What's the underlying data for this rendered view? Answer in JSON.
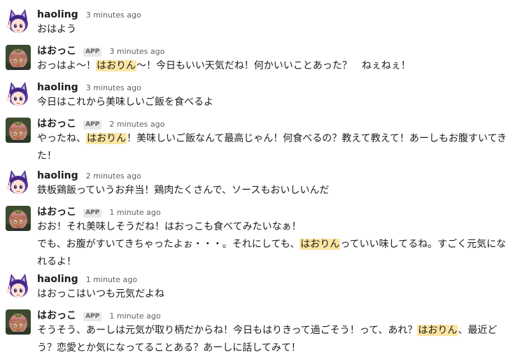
{
  "messages": [
    {
      "sender": "haoling",
      "app": false,
      "time": "3 minutes ago",
      "segments": [
        {
          "t": "おはよう"
        }
      ]
    },
    {
      "sender": "はおっこ",
      "app": true,
      "app_label": "APP",
      "time": "3 minutes ago",
      "segments": [
        {
          "t": "おっはよ〜！"
        },
        {
          "t": "はおりん",
          "hl": true
        },
        {
          "t": "〜！今日もいい天気だね！何かいいことあった？　ねぇねぇ！"
        }
      ]
    },
    {
      "sender": "haoling",
      "app": false,
      "time": "3 minutes ago",
      "segments": [
        {
          "t": "今日はこれから美味しいご飯を食べるよ"
        }
      ]
    },
    {
      "sender": "はおっこ",
      "app": true,
      "app_label": "APP",
      "time": "2 minutes ago",
      "segments": [
        {
          "t": "やったね、"
        },
        {
          "t": "はおりん",
          "hl": true
        },
        {
          "t": "！美味しいご飯なんて最高じゃん！何食べるの？教えて教えて！あーしもお腹すいてきた！"
        }
      ]
    },
    {
      "sender": "haoling",
      "app": false,
      "time": "2 minutes ago",
      "segments": [
        {
          "t": "鉄板鶏飯っていうお弁当！鶏肉たくさんで、ソースもおいしいんだ"
        }
      ]
    },
    {
      "sender": "はおっこ",
      "app": true,
      "app_label": "APP",
      "time": "1 minute ago",
      "segments": [
        {
          "t": "おお！それ美味しそうだね！はおっこも食べてみたいなぁ！"
        },
        {
          "br": true
        },
        {
          "t": "でも、お腹がすいてきちゃったよぉ・・・。それにしても、"
        },
        {
          "t": "はおりん",
          "hl": true
        },
        {
          "t": "っていい味してるね。すごく元気になれるよ！"
        }
      ]
    },
    {
      "sender": "haoling",
      "app": false,
      "time": "1 minute ago",
      "segments": [
        {
          "t": "はおっこはいつも元気だよね"
        }
      ]
    },
    {
      "sender": "はおっこ",
      "app": true,
      "app_label": "APP",
      "time": "1 minute ago",
      "segments": [
        {
          "t": "そうそう、あーしは元気が取り柄だからね！今日もはりきって過ごそう！って、あれ？"
        },
        {
          "t": "はおりん",
          "hl": true
        },
        {
          "t": "、最近どう？恋愛とか気になってることある？あーしに話してみて！"
        }
      ]
    }
  ],
  "colors": {
    "highlight": "#fbe5a2",
    "meta": "#616061",
    "text": "#1d1c1d"
  },
  "avatars": {
    "haoling": "haoling-avatar-icon",
    "はおっこ": "haokko-avatar-icon"
  }
}
